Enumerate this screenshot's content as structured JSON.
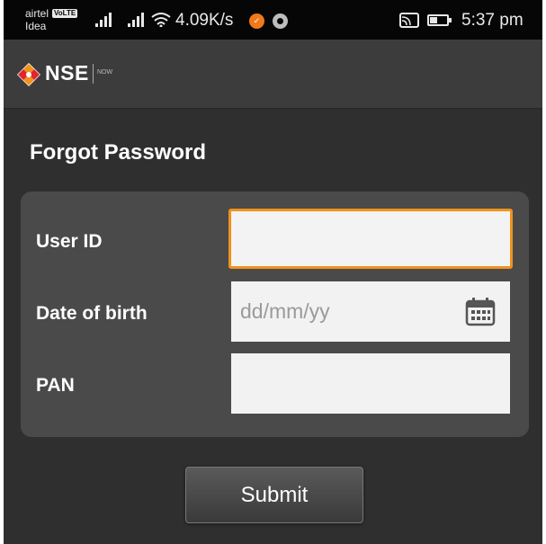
{
  "status_bar": {
    "carrier_primary": "airtel",
    "volte_badge": "VoLTE",
    "carrier_secondary": "Idea",
    "network_speed": "4.09K/s",
    "time": "5:37 pm",
    "icons": [
      "signal-icon",
      "signal-icon",
      "wifi-icon",
      "uc-browser-icon",
      "chrome-icon",
      "cast-icon",
      "battery-icon"
    ]
  },
  "app_bar": {
    "logo_text": "NSE",
    "logo_subtext": "NOW",
    "brand_color": "#f0921c"
  },
  "form": {
    "title": "Forgot Password",
    "fields": [
      {
        "label": "User ID",
        "value": "",
        "placeholder": ""
      },
      {
        "label": "Date of birth",
        "value": "",
        "placeholder": "dd/mm/yy"
      },
      {
        "label": "PAN",
        "value": "",
        "placeholder": ""
      }
    ],
    "submit_label": "Submit",
    "focus_color": "#f0921c"
  }
}
